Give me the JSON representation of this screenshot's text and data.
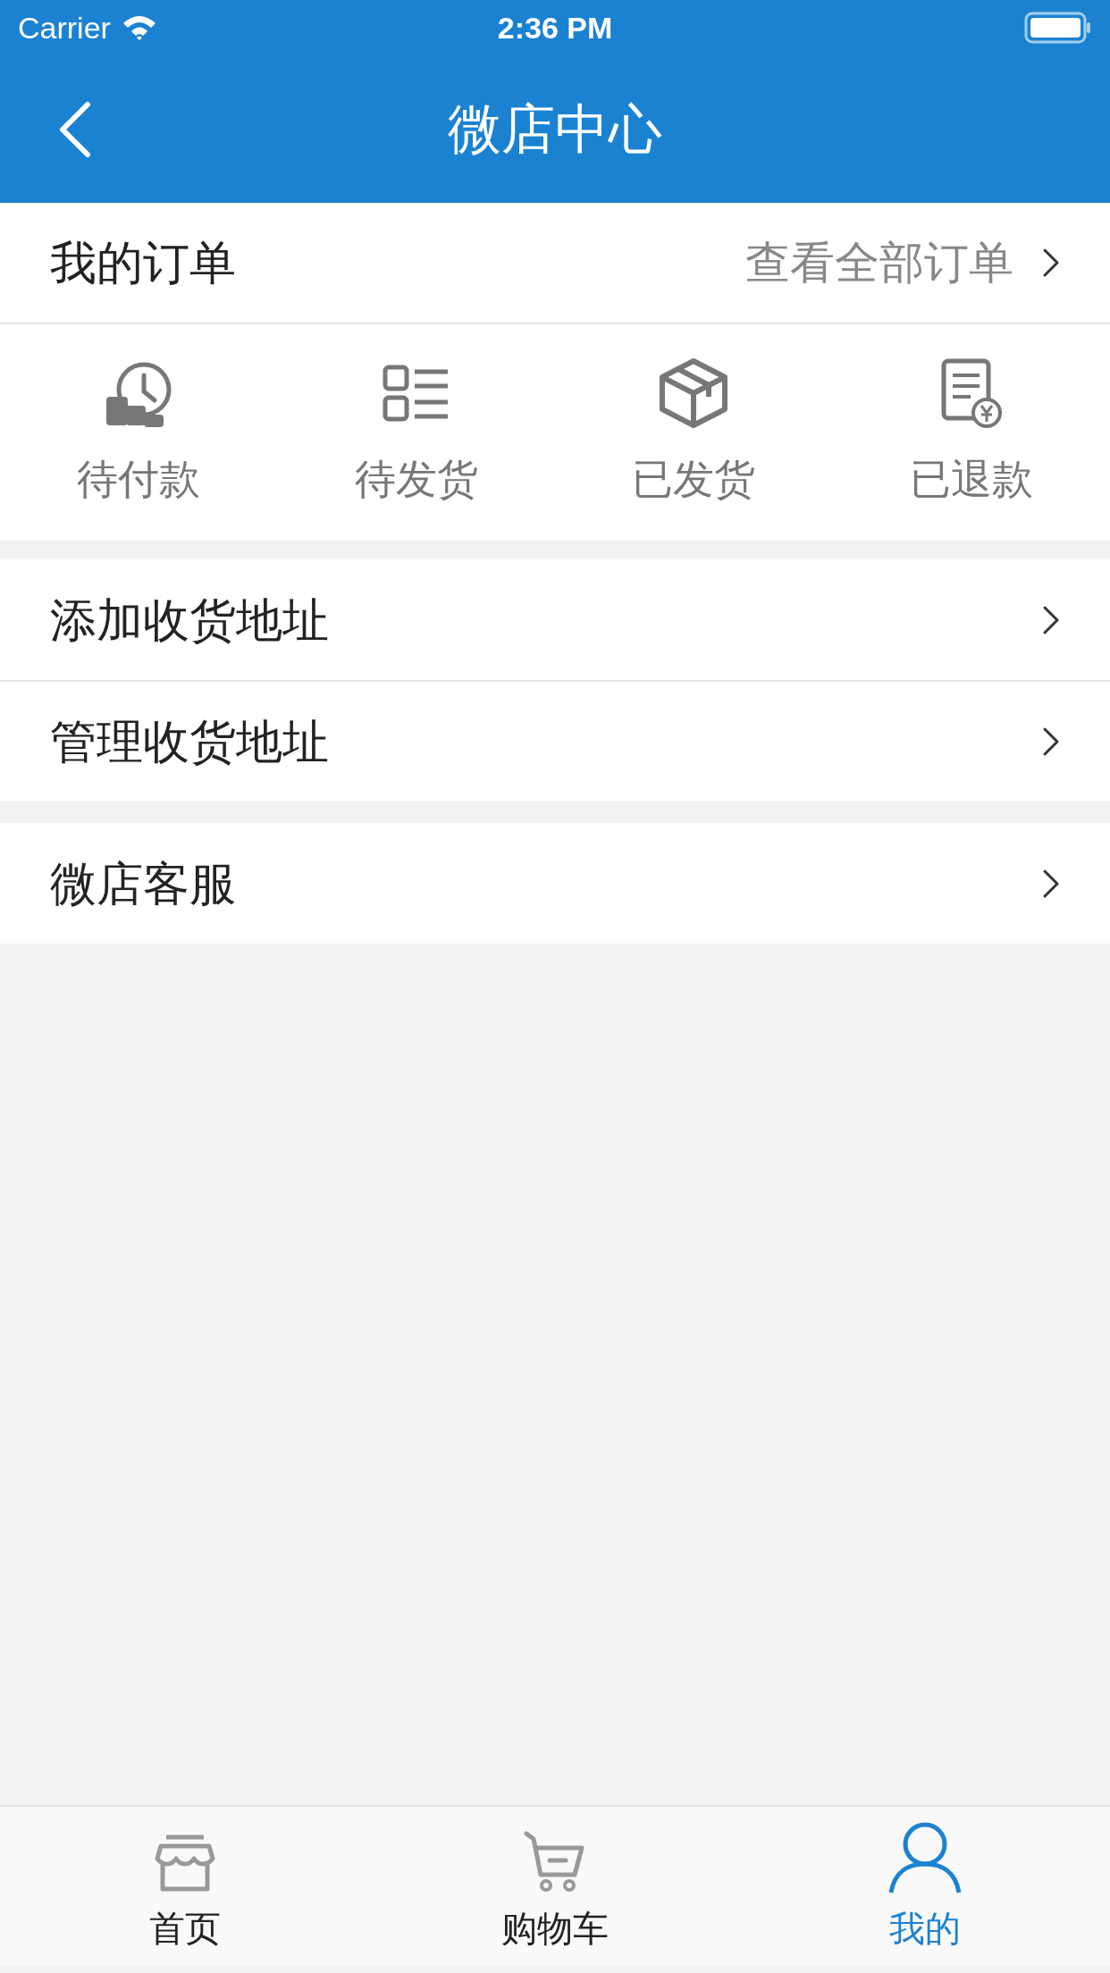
{
  "status_bar": {
    "carrier": "Carrier",
    "time": "2:36 PM"
  },
  "nav": {
    "title": "微店中心"
  },
  "orders": {
    "title": "我的订单",
    "link": "查看全部订单"
  },
  "order_statuses": [
    {
      "label": "待付款"
    },
    {
      "label": "待发货"
    },
    {
      "label": "已发货"
    },
    {
      "label": "已退款"
    }
  ],
  "menu_groups": [
    [
      {
        "label": "添加收货地址"
      },
      {
        "label": "管理收货地址"
      }
    ],
    [
      {
        "label": "微店客服"
      }
    ]
  ],
  "tab_bar": [
    {
      "label": "首页",
      "selected": false
    },
    {
      "label": "购物车",
      "selected": false
    },
    {
      "label": "我的",
      "selected": true
    }
  ]
}
